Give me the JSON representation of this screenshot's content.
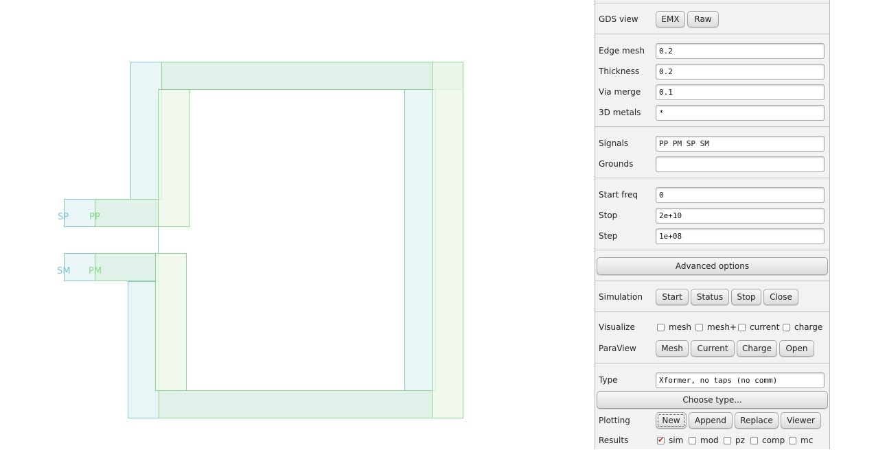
{
  "layout_view": {
    "ports": [
      {
        "label": "SP",
        "color": "#7fc3d6"
      },
      {
        "label": "PP",
        "color": "#86dc86"
      },
      {
        "label": "SM",
        "color": "#7fc3d6"
      },
      {
        "label": "PM",
        "color": "#86dc86"
      }
    ],
    "colors": {
      "blue_stroke": "#86c4d0",
      "blue_fill": "#e9f5f7",
      "green_stroke": "#8ed38e",
      "green_fill": "#edf8ea",
      "overlap_fill": "#d9eee4"
    }
  },
  "panel": {
    "gds_view": {
      "label": "GDS view",
      "buttons": [
        "EMX",
        "Raw"
      ]
    },
    "mesh": {
      "edge_mesh": {
        "label": "Edge mesh",
        "value": "0.2"
      },
      "thickness": {
        "label": "Thickness",
        "value": "0.2"
      },
      "via_merge": {
        "label": "Via merge",
        "value": "0.1"
      },
      "metals_3d": {
        "label": "3D metals",
        "value": "*"
      }
    },
    "nets": {
      "signals": {
        "label": "Signals",
        "value": "PP PM SP SM"
      },
      "grounds": {
        "label": "Grounds",
        "value": ""
      }
    },
    "freq": {
      "start": {
        "label": "Start freq",
        "value": "0"
      },
      "stop": {
        "label": "Stop",
        "value": "2e+10"
      },
      "step": {
        "label": "Step",
        "value": "1e+08"
      }
    },
    "advanced_label": "Advanced options",
    "simulation": {
      "label": "Simulation",
      "buttons": [
        "Start",
        "Status",
        "Stop",
        "Close"
      ]
    },
    "visualize": {
      "label": "Visualize",
      "options": [
        {
          "label": "mesh",
          "checked": false
        },
        {
          "label": "mesh+",
          "checked": false
        },
        {
          "label": "current",
          "checked": false
        },
        {
          "label": "charge",
          "checked": false
        }
      ]
    },
    "paraview": {
      "label": "ParaView",
      "buttons": [
        "Mesh",
        "Current",
        "Charge",
        "Open"
      ]
    },
    "type": {
      "label": "Type",
      "value": "Xformer, no taps (no comm)"
    },
    "choose_type_label": "Choose type...",
    "plotting": {
      "label": "Plotting",
      "buttons": [
        "New",
        "Append",
        "Replace",
        "Viewer"
      ]
    },
    "results": {
      "label": "Results",
      "options": [
        {
          "label": "sim",
          "checked": true
        },
        {
          "label": "mod",
          "checked": false
        },
        {
          "label": "pz",
          "checked": false
        },
        {
          "label": "comp",
          "checked": false
        },
        {
          "label": "mc",
          "checked": false
        }
      ]
    }
  }
}
